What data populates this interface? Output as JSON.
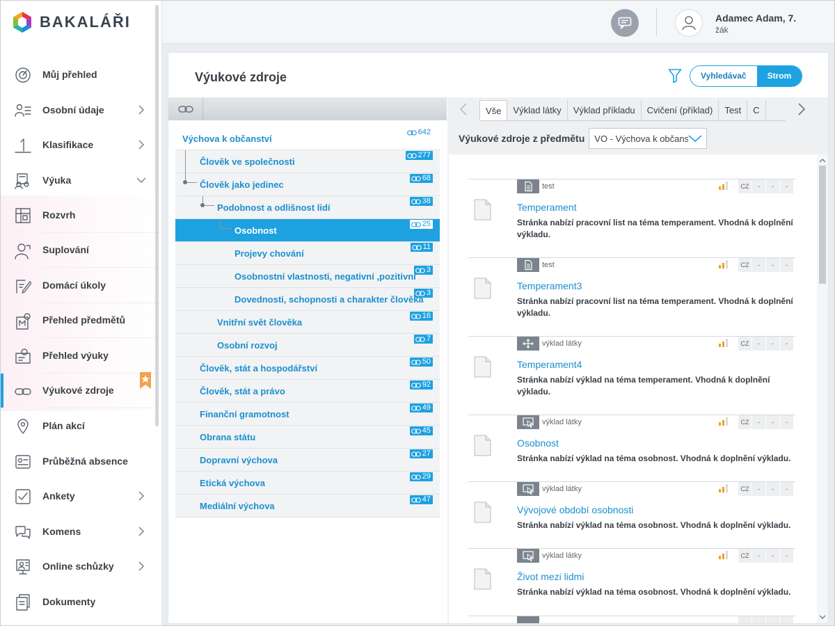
{
  "brand": {
    "name": "BAKALÁŘI"
  },
  "user": {
    "name": "Adamec Adam, 7.",
    "role": "žák"
  },
  "nav": [
    {
      "label": "Můj přehled",
      "icon": "dashboard-icon",
      "chevron": ""
    },
    {
      "label": "Osobní údaje",
      "icon": "id-card-icon",
      "chevron": "right"
    },
    {
      "label": "Klasifikace",
      "icon": "grade-one-icon",
      "chevron": "right"
    },
    {
      "label": "Výuka",
      "icon": "teaching-icon",
      "chevron": "down"
    },
    {
      "label": "Rozvrh",
      "icon": "timetable-icon",
      "sub": true
    },
    {
      "label": "Suplování",
      "icon": "substitution-icon",
      "sub": true
    },
    {
      "label": "Domácí úkoly",
      "icon": "homework-icon",
      "sub": true
    },
    {
      "label": "Přehled předmětů",
      "icon": "subjects-icon",
      "sub": true
    },
    {
      "label": "Přehled výuky",
      "icon": "lessons-icon",
      "sub": true
    },
    {
      "label": "Výukové zdroje",
      "icon": "link-icon",
      "sub": true,
      "active": true,
      "bookmarked": true
    },
    {
      "label": "Plán akcí",
      "icon": "location-pin-icon",
      "chevron": ""
    },
    {
      "label": "Průběžná absence",
      "icon": "absence-icon",
      "chevron": ""
    },
    {
      "label": "Ankety",
      "icon": "poll-icon",
      "chevron": "right"
    },
    {
      "label": "Komens",
      "icon": "chat-icon",
      "chevron": "right"
    },
    {
      "label": "Online schůzky",
      "icon": "video-meeting-icon",
      "chevron": "right"
    },
    {
      "label": "Dokumenty",
      "icon": "documents-icon",
      "chevron": ""
    }
  ],
  "main": {
    "title": "Výukové zdroje",
    "view_toggle": {
      "search_label": "Vyhledávač",
      "tree_label": "Strom",
      "selected": "Strom"
    }
  },
  "tree": [
    {
      "label": "Výchova k občanství",
      "count": "642",
      "level": 0
    },
    {
      "label": "Člověk ve společnosti",
      "count": "277",
      "level": 1
    },
    {
      "label": "Člověk jako jedinec",
      "count": "68",
      "level": 1
    },
    {
      "label": "Podobnost a odlišnost lidí",
      "count": "38",
      "level": 2
    },
    {
      "label": "Osobnost",
      "count": "25",
      "level": 3,
      "selected": true
    },
    {
      "label": "Projevy chování",
      "count": "11",
      "level": 3
    },
    {
      "label": "Osobnostní vlastnosti, negativní ,pozitivní",
      "count": "3",
      "level": 3
    },
    {
      "label": "Dovednosti, schopnosti a charakter člověka",
      "count": "3",
      "level": 3
    },
    {
      "label": "Vnitřní svět člověka",
      "count": "16",
      "level": 2
    },
    {
      "label": "Osobní rozvoj",
      "count": "7",
      "level": 2
    },
    {
      "label": "Člověk, stát a hospodářství",
      "count": "50",
      "level": 1
    },
    {
      "label": "Člověk, stát a právo",
      "count": "92",
      "level": 1
    },
    {
      "label": "Finanční gramotnost",
      "count": "49",
      "level": 1
    },
    {
      "label": "Obrana státu",
      "count": "45",
      "level": 1
    },
    {
      "label": "Dopravní výchova",
      "count": "27",
      "level": 1
    },
    {
      "label": "Etická výchova",
      "count": "29",
      "level": 1
    },
    {
      "label": "Mediální výchova",
      "count": "47",
      "level": 1
    }
  ],
  "tabs": [
    "Vše",
    "Výklad látky",
    "Výklad příkladu",
    "Cvičení (příklad)",
    "Test",
    "C"
  ],
  "active_tab": "Vše",
  "subject_filter": {
    "label": "Výukové zdroje z předmětu",
    "value": "VO - Výchova k občanství"
  },
  "resources": [
    {
      "type": "test",
      "type_icon": "document-lines-icon",
      "lang": "CZ",
      "title": "Temperament",
      "desc": "Stránka nabízí pracovní list na téma temperament. Vhodná k doplnění výkladu."
    },
    {
      "type": "test",
      "type_icon": "document-lines-icon",
      "lang": "CZ",
      "title": "Temperament3",
      "desc": "Stránka nabízí pracovní list na téma temperament. Vhodná k doplnění výkladu."
    },
    {
      "type": "výklad látky",
      "type_icon": "move-arrows-icon",
      "lang": "CZ",
      "title": "Temperament4",
      "desc": "Stránka nabízí výklad na téma temperament. Vhodná k doplnění výkladu."
    },
    {
      "type": "výklad látky",
      "type_icon": "pointer-screen-icon",
      "lang": "CZ",
      "title": "Osobnost",
      "desc": "Stránka nabízí výklad na téma osobnost. Vhodná k doplnění výkladu."
    },
    {
      "type": "výklad látky",
      "type_icon": "pointer-screen-icon",
      "lang": "CZ",
      "title": "Vývojové období osobnosti",
      "desc": "Stránka nabízí výklad na téma osobnost. Vhodná k doplnění výkladu."
    },
    {
      "type": "výklad látky",
      "type_icon": "pointer-screen-icon",
      "lang": "CZ",
      "title": "Život mezi lidmi",
      "desc": "Stránka nabízí výklad na téma osobnost. Vhodná k doplnění výkladu."
    }
  ],
  "colors": {
    "accent": "#1ea1e0",
    "link": "#1b8fd0",
    "level_low": "#f0a020"
  }
}
